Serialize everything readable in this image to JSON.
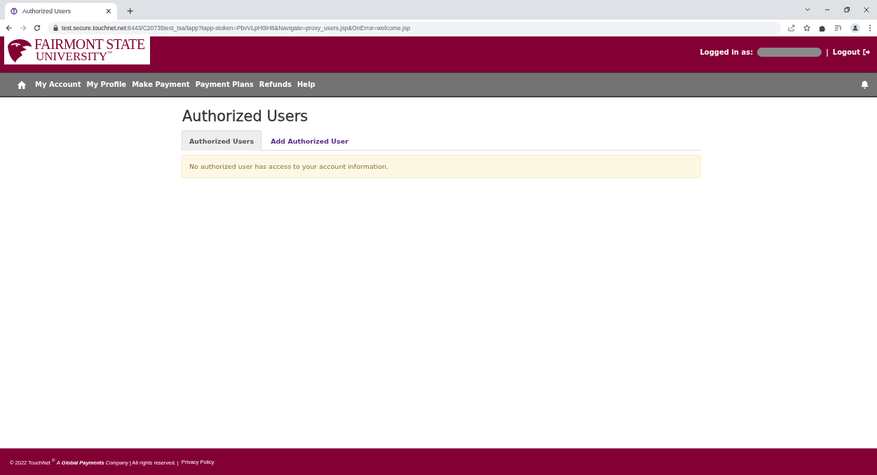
{
  "browser": {
    "tab_title": "Authorized Users",
    "tab_close": "×",
    "new_tab": "+",
    "url_host": "test.secure.touchnet.net",
    "url_rest": ":8443/C20735test_tsa/tapp?tapp-stoken=PbvVLpH0iH8&Navigate=proxy_users.jsp&OnError=welcome.jsp"
  },
  "header": {
    "logo_line_1": "FAIRMONT STATE",
    "logo_line_2": "UNIVERSITY",
    "logo_mark": "™",
    "logged_in_label": "Logged in as:",
    "separator": "|",
    "logout": "Logout"
  },
  "nav": {
    "items": [
      {
        "label": "My Account"
      },
      {
        "label": "My Profile"
      },
      {
        "label": "Make Payment"
      },
      {
        "label": "Payment Plans"
      },
      {
        "label": "Refunds"
      },
      {
        "label": "Help"
      }
    ]
  },
  "page": {
    "title": "Authorized Users",
    "tabs": [
      {
        "label": "Authorized Users",
        "selected": true
      },
      {
        "label": "Add Authorized User",
        "selected": false
      }
    ],
    "alert": "No authorized user has access to your account information."
  },
  "footer": {
    "text": "© 2022 TouchNet $^{®}$ *A* **Global Payments** *Company* | All rights reserved. |",
    "link": "Privacy Policy"
  }
}
